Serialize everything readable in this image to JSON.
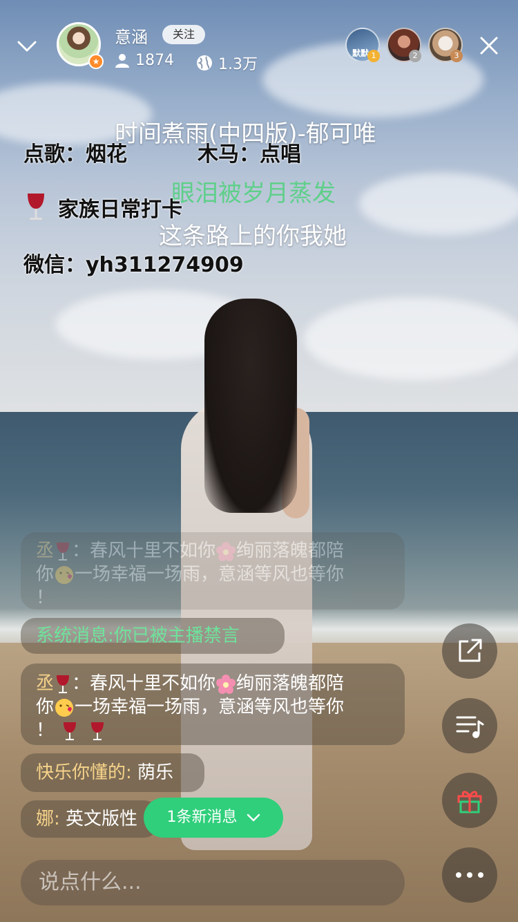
{
  "header": {
    "anchor_name": "意涵",
    "follow_label": "关注",
    "viewer_count": "1874",
    "popularity": "1.3万",
    "top_viewers": [
      {
        "rank": "1",
        "color": "#f2b233"
      },
      {
        "rank": "2",
        "color": "#a8a8a8"
      },
      {
        "rank": "3",
        "color": "#c88a55"
      }
    ],
    "top_viewer_1_text": "默默"
  },
  "overlay": {
    "song_title": "时间煮雨(中四版)-郁可唯",
    "notice_request": "点歌：烟花",
    "notice_host": "木马：点唱",
    "notice_clock": "家族日常打卡",
    "notice_wechat": "微信：yh311274909",
    "lyric_current": "眼泪被岁月蒸发",
    "lyric_next": "这条路上的你我她"
  },
  "chat": {
    "messages": [
      {
        "user": "丞",
        "text_a": "春风十里不如你",
        "text_b": "绚丽落魄都陪",
        "text_c": "你",
        "text_d": "一场幸福一场雨，意涵等风也等你",
        "text_e": "！"
      },
      {
        "system_label": "系统消息:",
        "system_text": "你已被主播禁言"
      },
      {
        "user": "丞",
        "text_a": "春风十里不如你",
        "text_b": "绚丽落魄都陪",
        "text_c": "你",
        "text_d": "一场幸福一场雨，意涵等风也等你",
        "text_e": "！"
      },
      {
        "user": "快乐你懂的:",
        "text": "荫乐"
      },
      {
        "user": "娜:",
        "text": "英文版性"
      }
    ],
    "new_message_label": "1条新消息",
    "input_placeholder": "说点什么..."
  },
  "colors": {
    "accent_green": "#2fcf7b",
    "system_green": "#6ee39b",
    "username_gold": "#f6d38a",
    "gift_red": "#ff4b4b"
  },
  "icons": [
    "chevron-down-icon",
    "person-icon",
    "globe-icon",
    "close-icon",
    "share-icon",
    "playlist-icon",
    "gift-icon",
    "more-icon",
    "wine-glass-icon",
    "flower-icon",
    "kiss-emoji-icon"
  ]
}
